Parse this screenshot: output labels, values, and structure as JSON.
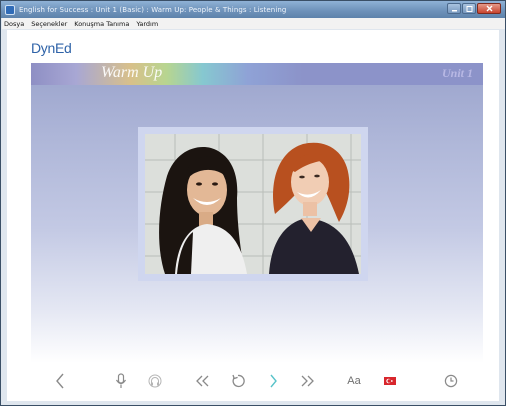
{
  "window": {
    "title": "English for Success : Unit 1 (Basic) : Warm Up: People & Things : Listening",
    "controls": [
      "minimize",
      "maximize",
      "close"
    ]
  },
  "menu": {
    "items": [
      {
        "label": "Dosya"
      },
      {
        "label": "Seçenekler"
      },
      {
        "label": "Konuşma Tanıma"
      },
      {
        "label": "Yardım"
      }
    ]
  },
  "logo": {
    "text": "DynEd"
  },
  "banner": {
    "title": "Warm Up",
    "unit": "Unit 1"
  },
  "photo": {
    "subject": "two-women-smiling-photo"
  },
  "toolbar": {
    "buttons": [
      {
        "name": "back-button",
        "icon": "chevron-left-icon"
      },
      {
        "name": "record-button",
        "icon": "microphone-icon"
      },
      {
        "name": "playback-button",
        "icon": "headphones-icon"
      },
      {
        "name": "rewind-button",
        "icon": "double-chevron-left-icon"
      },
      {
        "name": "repeat-button",
        "icon": "repeat-icon"
      },
      {
        "name": "next-button",
        "icon": "chevron-right-icon"
      },
      {
        "name": "fast-forward-button",
        "icon": "double-chevron-right-icon"
      },
      {
        "name": "text-button",
        "label": "Aa"
      },
      {
        "name": "language-button",
        "icon": "turkish-flag-icon"
      },
      {
        "name": "timer-button",
        "icon": "clock-icon"
      }
    ],
    "text_label": "Aa"
  },
  "colors": {
    "brand": "#2f63a8",
    "next_accent": "#58c3c9",
    "flag_red": "#d8262c"
  }
}
